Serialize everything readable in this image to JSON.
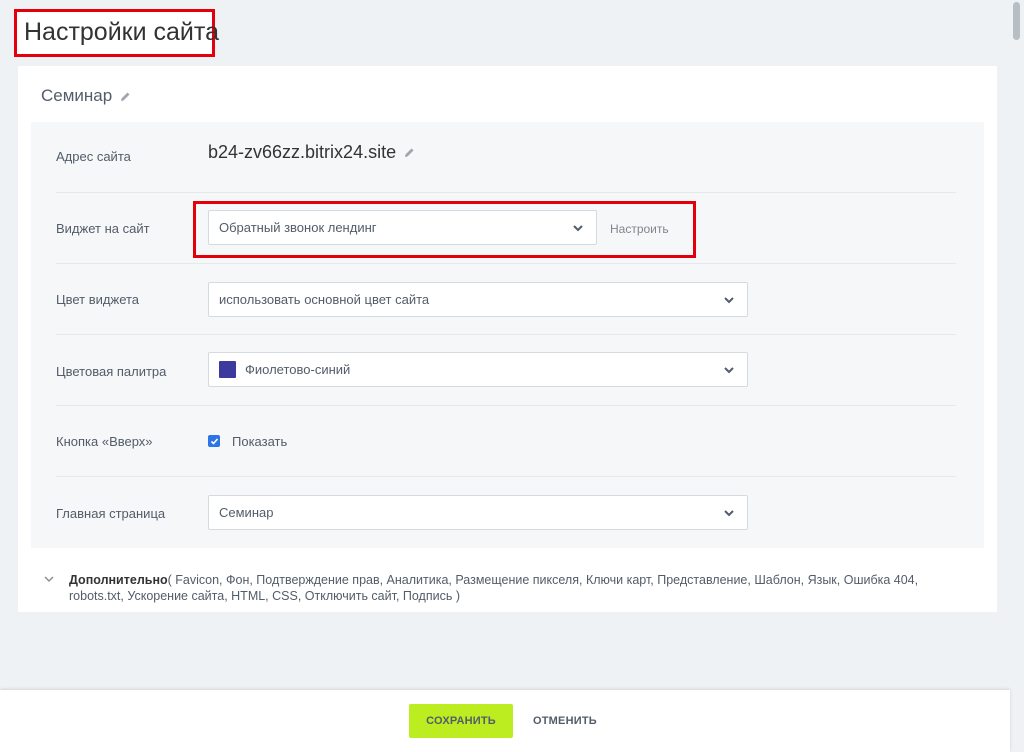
{
  "page": {
    "title": "Настройки сайта"
  },
  "site": {
    "name": "Семинар"
  },
  "rows": {
    "address": {
      "label": "Адрес сайта",
      "value": "b24-zv66zz.bitrix24.site"
    },
    "widget": {
      "label": "Виджет на сайт",
      "selected": "Обратный звонок лендинг",
      "configure_label": "Настроить"
    },
    "widget_color": {
      "label": "Цвет виджета",
      "selected": "использовать основной цвет сайта"
    },
    "palette": {
      "label": "Цветовая палитра",
      "selected": "Фиолетово-синий",
      "swatch_color": "#3c3a9d"
    },
    "up_button": {
      "label": "Кнопка «Вверх»",
      "checkbox_label": "Показать",
      "checked": true
    },
    "home_page": {
      "label": "Главная страница",
      "selected": "Семинар"
    }
  },
  "additional": {
    "label": "Дополнительно",
    "items": "( Favicon,  Фон,  Подтверждение прав,  Аналитика,  Размещение пикселя,  Ключи карт,  Представление,  Шаблон,  Язык,  Ошибка 404,  robots.txt,  Ускорение сайта,  HTML,  CSS,  Отключить сайт,  Подпись )"
  },
  "footer": {
    "save_label": "СОХРАНИТЬ",
    "cancel_label": "ОТМЕНИТЬ"
  },
  "colors": {
    "accent_save": "#bbed21",
    "highlight_border": "#e3000b",
    "checkbox": "#2d75e6",
    "background": "#eef2f4"
  },
  "icons": {
    "site_name_edit": "pencil-icon",
    "domain_edit": "pencil-icon",
    "select_arrow": "chevron-down-icon",
    "additional_toggle": "chevron-down-icon",
    "checkbox": "checkmark-icon"
  }
}
